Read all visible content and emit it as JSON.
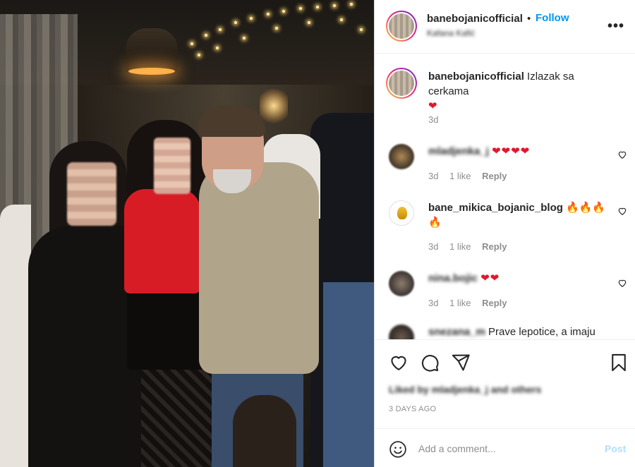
{
  "post": {
    "author": "banebojanicofficial",
    "follow_label": "Follow",
    "separator": "•",
    "location": "Kafana Kafić",
    "more_label": "•••"
  },
  "caption": {
    "username": "banebojanicofficial",
    "text": "Izlazak sa cerkama",
    "emoji": "❤",
    "time": "3d"
  },
  "comments": [
    {
      "username": "mladjenka_j",
      "text": "❤❤❤❤",
      "time": "3d",
      "likes": "1 like",
      "reply": "Reply"
    },
    {
      "username": "bane_mikica_bojanic_blog",
      "text": "🔥🔥🔥🔥",
      "time": "3d",
      "likes": "1 like",
      "reply": "Reply"
    },
    {
      "username": "nina.bojic",
      "text": "❤❤",
      "time": "3d",
      "likes": "1 like",
      "reply": "Reply"
    },
    {
      "username": "snezana_m",
      "text": "Prave lepotice, a imaju",
      "time": "",
      "likes": "",
      "reply": ""
    }
  ],
  "actions": {
    "like_icon": "heart-outline-icon",
    "comment_icon": "comment-bubble-icon",
    "share_icon": "paper-plane-icon",
    "save_icon": "bookmark-icon"
  },
  "likes_text": "Liked by mladjenka_j and others",
  "date": "3 DAYS AGO",
  "add_comment": {
    "placeholder": "Add a comment...",
    "post_label": "Post",
    "emoji_icon": "smiley-icon"
  },
  "colors": {
    "accent": "#0095f6",
    "heart": "#e0182d",
    "muted": "#8e8e8e",
    "post_disabled": "#b2dffc"
  }
}
